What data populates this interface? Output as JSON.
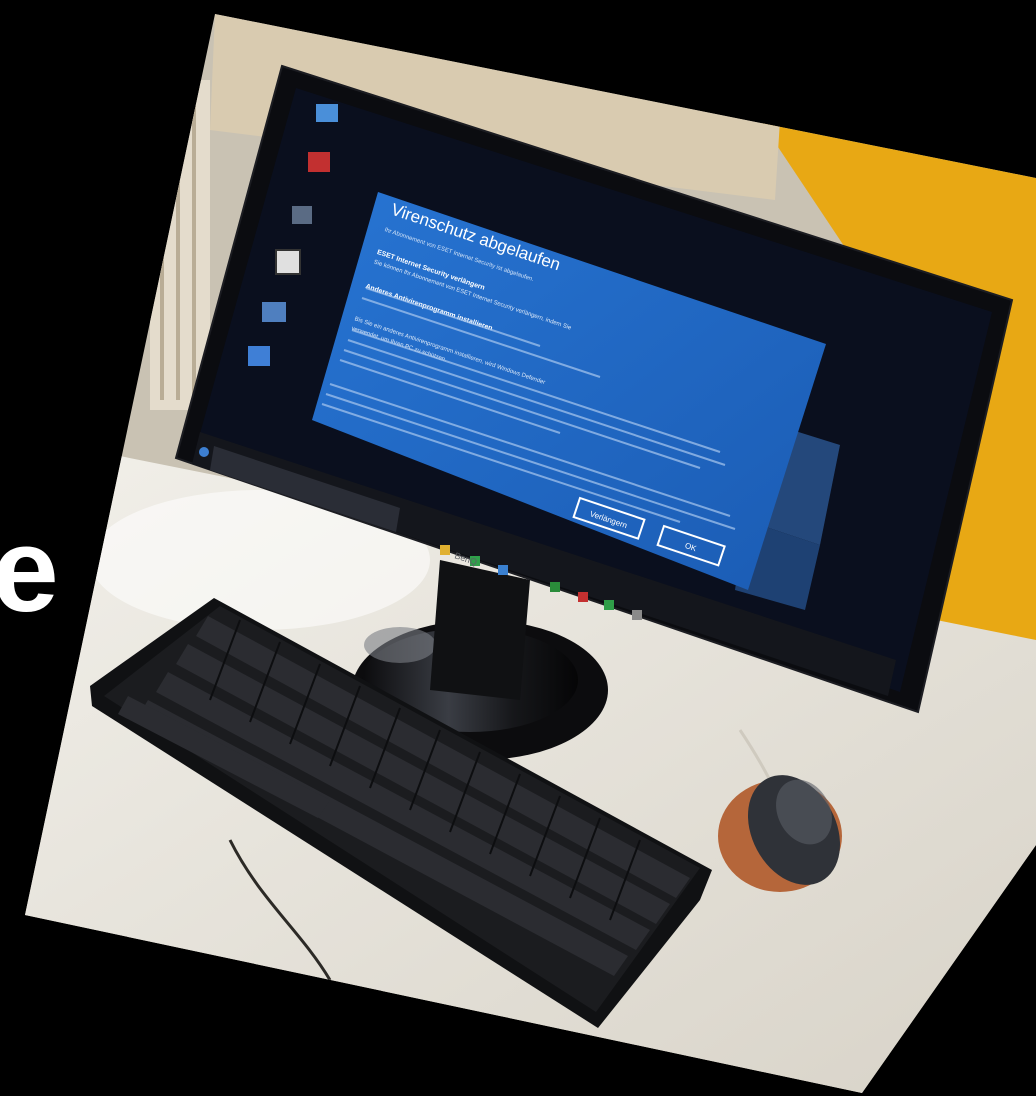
{
  "side_text": "e",
  "photo": {
    "monitor_brand": "BenQ",
    "dialog": {
      "title": "Virenschutz abgelaufen",
      "subtitle": "Ihr Abonnement von ESET Internet Security ist abgelaufen.",
      "heading1": "ESET Internet Security verlängern",
      "body1": "Sie können Ihr Abonnement von ESET Internet Security verlängern, indem Sie",
      "heading2": "Anderes Antivirenprogramm installieren",
      "body2": "Bis Sie ein anderes Antivirenprogramm installieren, wird Windows Defender",
      "body3": "verwendet, um Ihren PC zu schützen.",
      "button_left": "Verlängern",
      "button_ok": "OK"
    }
  },
  "colors": {
    "background": "#000000",
    "dialog_blue": "#1f67c4",
    "wall_yellow": "#e8a814",
    "desk": "#e9e6df",
    "screen": "#0a0f1e",
    "mousepad": "#b5663a"
  }
}
